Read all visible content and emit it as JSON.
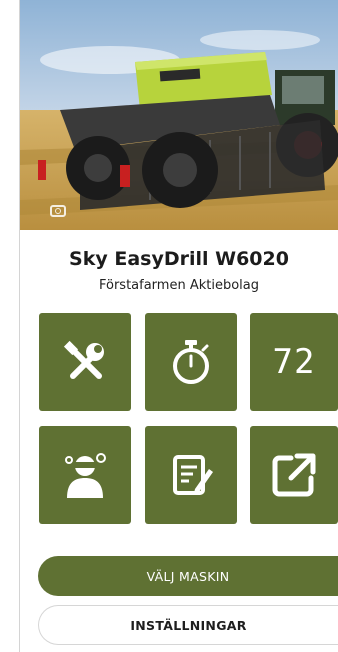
{
  "machine": {
    "name": "Sky EasyDrill W6020",
    "owner": "Förstafarmen Aktiebolag",
    "image_icon": "camera-icon"
  },
  "tiles": [
    {
      "icon": "wrench-screwdriver-icon"
    },
    {
      "icon": "stopwatch-icon"
    },
    {
      "icon": "counter-display",
      "value": "72"
    },
    {
      "icon": "mechanic-icon"
    },
    {
      "icon": "note-edit-icon"
    },
    {
      "icon": "external-link-icon"
    }
  ],
  "buttons": {
    "select_machine": "VÄLJ MASKIN",
    "settings": "INSTÄLLNINGAR"
  },
  "colors": {
    "accent": "#5f7133",
    "machine_body": "#b7d33c"
  }
}
